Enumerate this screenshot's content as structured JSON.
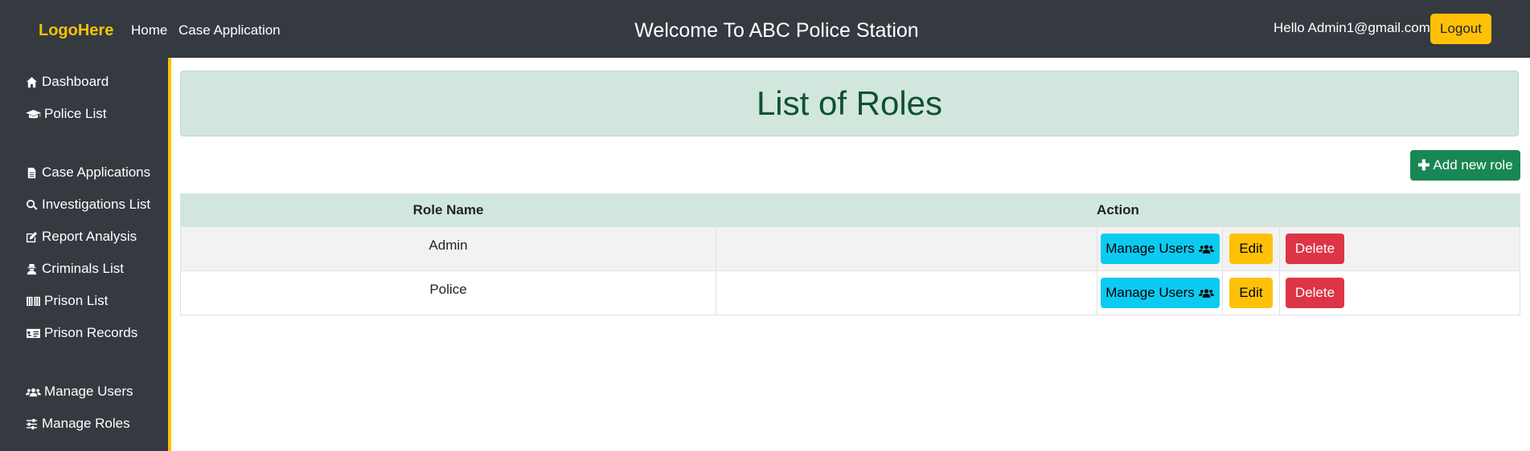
{
  "navbar": {
    "logo": "LogoHere",
    "links": [
      "Home",
      "Case Application"
    ],
    "title": "Welcome To ABC Police Station",
    "greeting": "Hello Admin1@gmail.com!",
    "logout_label": "Logout"
  },
  "sidebar": {
    "items": [
      {
        "label": "Dashboard",
        "icon": "home-icon"
      },
      {
        "label": "Police List",
        "icon": "graduation-cap-icon"
      },
      {
        "label": "Case Applications",
        "icon": "file-icon"
      },
      {
        "label": "Investigations List",
        "icon": "search-icon"
      },
      {
        "label": "Report Analysis",
        "icon": "edit-icon"
      },
      {
        "label": "Criminals List",
        "icon": "user-secret-icon"
      },
      {
        "label": "Prison List",
        "icon": "prison-icon"
      },
      {
        "label": "Prison Records",
        "icon": "id-card-icon"
      },
      {
        "label": "Manage Users",
        "icon": "users-icon"
      },
      {
        "label": "Manage Roles",
        "icon": "sliders-icon"
      }
    ]
  },
  "main": {
    "title": "List of Roles",
    "add_button_label": "Add new role",
    "table": {
      "headers": [
        "Role Name",
        "Action"
      ],
      "rows": [
        {
          "role": "Admin",
          "manage_label": "Manage Users",
          "edit_label": "Edit",
          "delete_label": "Delete"
        },
        {
          "role": "Police",
          "manage_label": "Manage Users",
          "edit_label": "Edit",
          "delete_label": "Delete"
        }
      ]
    }
  },
  "colors": {
    "navbar": "#343a40",
    "accent": "#ffc107",
    "success": "#198754",
    "info": "#0dcaf0",
    "danger": "#dc3545",
    "banner_bg": "#d1e7dd"
  }
}
